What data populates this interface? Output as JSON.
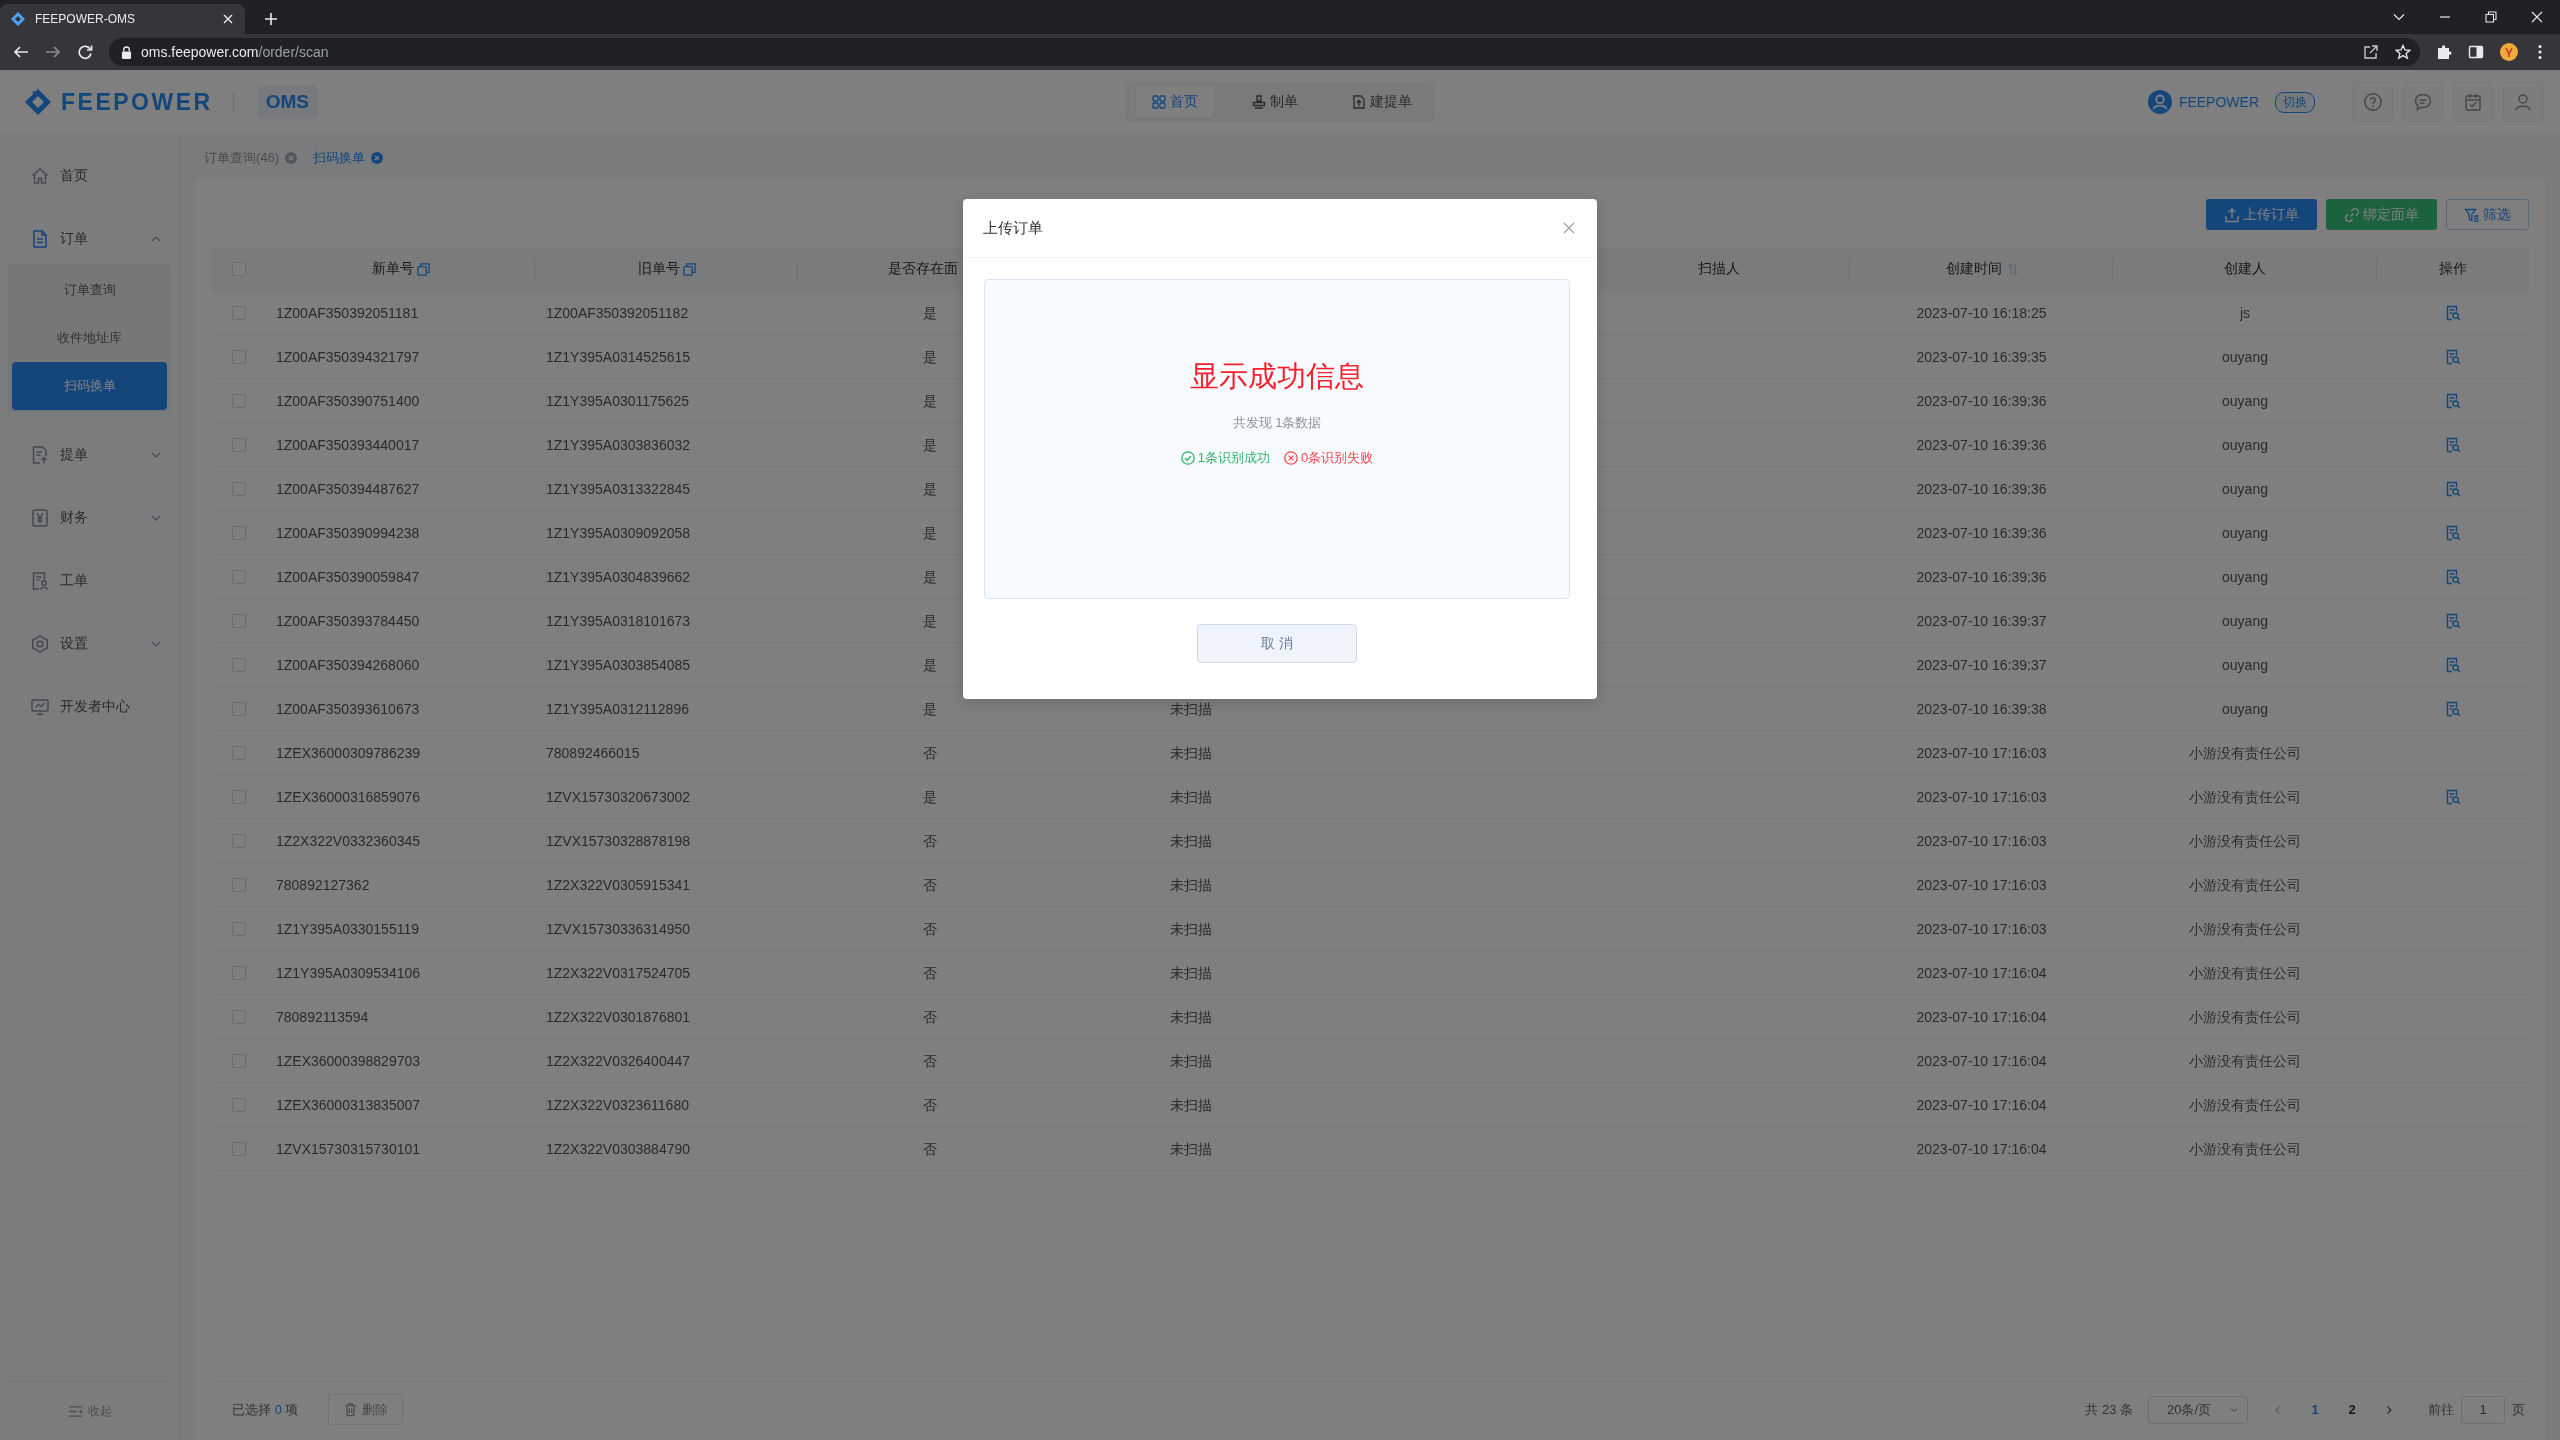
{
  "browser": {
    "tab_title": "FEEPOWER-OMS",
    "url": "oms.feepower.com/order/scan"
  },
  "header": {
    "brand": "FEEPOWER",
    "product": "OMS",
    "nav": [
      {
        "label": "首页",
        "selected": true
      },
      {
        "label": "制单",
        "selected": false
      },
      {
        "label": "建提单",
        "selected": false
      }
    ],
    "user": "FEEPOWER",
    "switch_label": "切换"
  },
  "sidebar": {
    "items": [
      {
        "label": "首页",
        "kind": "link",
        "selected": false
      },
      {
        "label": "订单",
        "kind": "group",
        "selected": true,
        "expanded": true,
        "children": [
          {
            "label": "订单查询",
            "selected": false
          },
          {
            "label": "收件地址库",
            "selected": false
          },
          {
            "label": "扫码换单",
            "selected": true
          }
        ]
      },
      {
        "label": "提单",
        "kind": "group",
        "selected": false,
        "expanded": false
      },
      {
        "label": "财务",
        "kind": "group",
        "selected": false,
        "expanded": false
      },
      {
        "label": "工单",
        "kind": "link",
        "selected": false
      },
      {
        "label": "设置",
        "kind": "group",
        "selected": false,
        "expanded": false
      },
      {
        "label": "开发者中心",
        "kind": "link",
        "selected": false
      }
    ],
    "collapse_label": "收起"
  },
  "page_tabs": [
    {
      "label": "订单查询(46)",
      "selected": false
    },
    {
      "label": "扫码换单",
      "selected": true
    }
  ],
  "toolbar": [
    {
      "label": "上传订单",
      "kind": "upload"
    },
    {
      "label": "绑定面单",
      "kind": "link"
    },
    {
      "label": "筛选",
      "kind": "filter"
    }
  ],
  "table": {
    "select_all_checked": false,
    "columns": [
      {
        "label": "新单号",
        "kind": "copyable"
      },
      {
        "label": "旧单号",
        "kind": "copyable"
      },
      {
        "label": "是否存在面",
        "kind": "plain"
      },
      {
        "label": "扫描人",
        "kind": "plain"
      },
      {
        "label": "创建时间",
        "kind": "sortable"
      },
      {
        "label": "创建人",
        "kind": "plain"
      },
      {
        "label": "操作",
        "kind": "plain"
      }
    ],
    "rows": [
      {
        "checked": false,
        "new_no": "1Z00AF350392051181",
        "old_no": "1Z00AF350392051182",
        "has_label": "是",
        "created_at": "2023-07-10 16:18:25",
        "creator": "js",
        "viewable": true
      },
      {
        "checked": false,
        "new_no": "1Z00AF350394321797",
        "old_no": "1Z1Y395A0314525615",
        "has_label": "是",
        "created_at": "2023-07-10 16:39:35",
        "creator": "ouyang",
        "viewable": true
      },
      {
        "checked": false,
        "new_no": "1Z00AF350390751400",
        "old_no": "1Z1Y395A0301175625",
        "has_label": "是",
        "created_at": "2023-07-10 16:39:36",
        "creator": "ouyang",
        "viewable": true
      },
      {
        "checked": false,
        "new_no": "1Z00AF350393440017",
        "old_no": "1Z1Y395A0303836032",
        "has_label": "是",
        "created_at": "2023-07-10 16:39:36",
        "creator": "ouyang",
        "viewable": true
      },
      {
        "checked": false,
        "new_no": "1Z00AF350394487627",
        "old_no": "1Z1Y395A0313322845",
        "has_label": "是",
        "created_at": "2023-07-10 16:39:36",
        "creator": "ouyang",
        "viewable": true
      },
      {
        "checked": false,
        "new_no": "1Z00AF350390994238",
        "old_no": "1Z1Y395A0309092058",
        "has_label": "是",
        "created_at": "2023-07-10 16:39:36",
        "creator": "ouyang",
        "viewable": true
      },
      {
        "checked": false,
        "new_no": "1Z00AF350390059847",
        "old_no": "1Z1Y395A0304839662",
        "has_label": "是",
        "created_at": "2023-07-10 16:39:36",
        "creator": "ouyang",
        "viewable": true
      },
      {
        "checked": false,
        "new_no": "1Z00AF350393784450",
        "old_no": "1Z1Y395A0318101673",
        "has_label": "是",
        "created_at": "2023-07-10 16:39:37",
        "creator": "ouyang",
        "viewable": true
      },
      {
        "checked": false,
        "new_no": "1Z00AF350394268060",
        "old_no": "1Z1Y395A0303854085",
        "has_label": "是",
        "created_at": "2023-07-10 16:39:37",
        "creator": "ouyang",
        "viewable": true
      },
      {
        "checked": false,
        "new_no": "1Z00AF350393610673",
        "old_no": "1Z1Y395A0312112896",
        "has_label": "是",
        "column_4": "未扫描",
        "created_at": "2023-07-10 16:39:38",
        "creator": "ouyang",
        "viewable": true
      },
      {
        "checked": false,
        "new_no": "1ZEX36000309786239",
        "old_no": "780892466015",
        "has_label": "否",
        "column_4": "未扫描",
        "created_at": "2023-07-10 17:16:03",
        "creator": "小游没有责任公司",
        "viewable": false
      },
      {
        "checked": false,
        "new_no": "1ZEX36000316859076",
        "old_no": "1ZVX15730320673002",
        "has_label": "是",
        "column_4": "未扫描",
        "created_at": "2023-07-10 17:16:03",
        "creator": "小游没有责任公司",
        "viewable": true
      },
      {
        "checked": false,
        "new_no": "1Z2X322V0332360345",
        "old_no": "1ZVX15730328878198",
        "has_label": "否",
        "column_4": "未扫描",
        "created_at": "2023-07-10 17:16:03",
        "creator": "小游没有责任公司",
        "viewable": false
      },
      {
        "checked": false,
        "new_no": "780892127362",
        "old_no": "1Z2X322V0305915341",
        "has_label": "否",
        "column_4": "未扫描",
        "created_at": "2023-07-10 17:16:03",
        "creator": "小游没有责任公司",
        "viewable": false
      },
      {
        "checked": false,
        "new_no": "1Z1Y395A0330155119",
        "old_no": "1ZVX15730336314950",
        "has_label": "否",
        "column_4": "未扫描",
        "created_at": "2023-07-10 17:16:03",
        "creator": "小游没有责任公司",
        "viewable": false
      },
      {
        "checked": false,
        "new_no": "1Z1Y395A0309534106",
        "old_no": "1Z2X322V0317524705",
        "has_label": "否",
        "column_4": "未扫描",
        "created_at": "2023-07-10 17:16:04",
        "creator": "小游没有责任公司",
        "viewable": false
      },
      {
        "checked": false,
        "new_no": "780892113594",
        "old_no": "1Z2X322V0301876801",
        "has_label": "否",
        "column_4": "未扫描",
        "created_at": "2023-07-10 17:16:04",
        "creator": "小游没有责任公司",
        "viewable": false
      },
      {
        "checked": false,
        "new_no": "1ZEX36000398829703",
        "old_no": "1Z2X322V0326400447",
        "has_label": "否",
        "column_4": "未扫描",
        "created_at": "2023-07-10 17:16:04",
        "creator": "小游没有责任公司",
        "viewable": false
      },
      {
        "checked": false,
        "new_no": "1ZEX36000313835007",
        "old_no": "1Z2X322V0323611680",
        "has_label": "否",
        "column_4": "未扫描",
        "created_at": "2023-07-10 17:16:04",
        "creator": "小游没有责任公司",
        "viewable": false
      },
      {
        "checked": false,
        "new_no": "1ZVX15730315730101",
        "old_no": "1Z2X322V0303884790",
        "has_label": "否",
        "column_4": "未扫描",
        "created_at": "2023-07-10 17:16:04",
        "creator": "小游没有责任公司",
        "viewable": false
      }
    ]
  },
  "footer": {
    "selected_prefix": "已选择",
    "selected_count": "0",
    "selected_suffix": "项",
    "delete_label": "删除",
    "delete_disabled": true,
    "total": "共 23 条",
    "page_size": "20条/页",
    "pages": [
      {
        "label": "1",
        "selected": true
      },
      {
        "label": "2",
        "selected": false
      }
    ],
    "goto_label": "前往",
    "goto_value": "1",
    "goto_suffix": "页"
  },
  "modal": {
    "title": "上传订单",
    "headline": "显示成功信息",
    "summary": "共发现 1条数据",
    "success_text": "1条识别成功",
    "failure_text": "0条识别失败",
    "cancel_label": "取 消"
  }
}
